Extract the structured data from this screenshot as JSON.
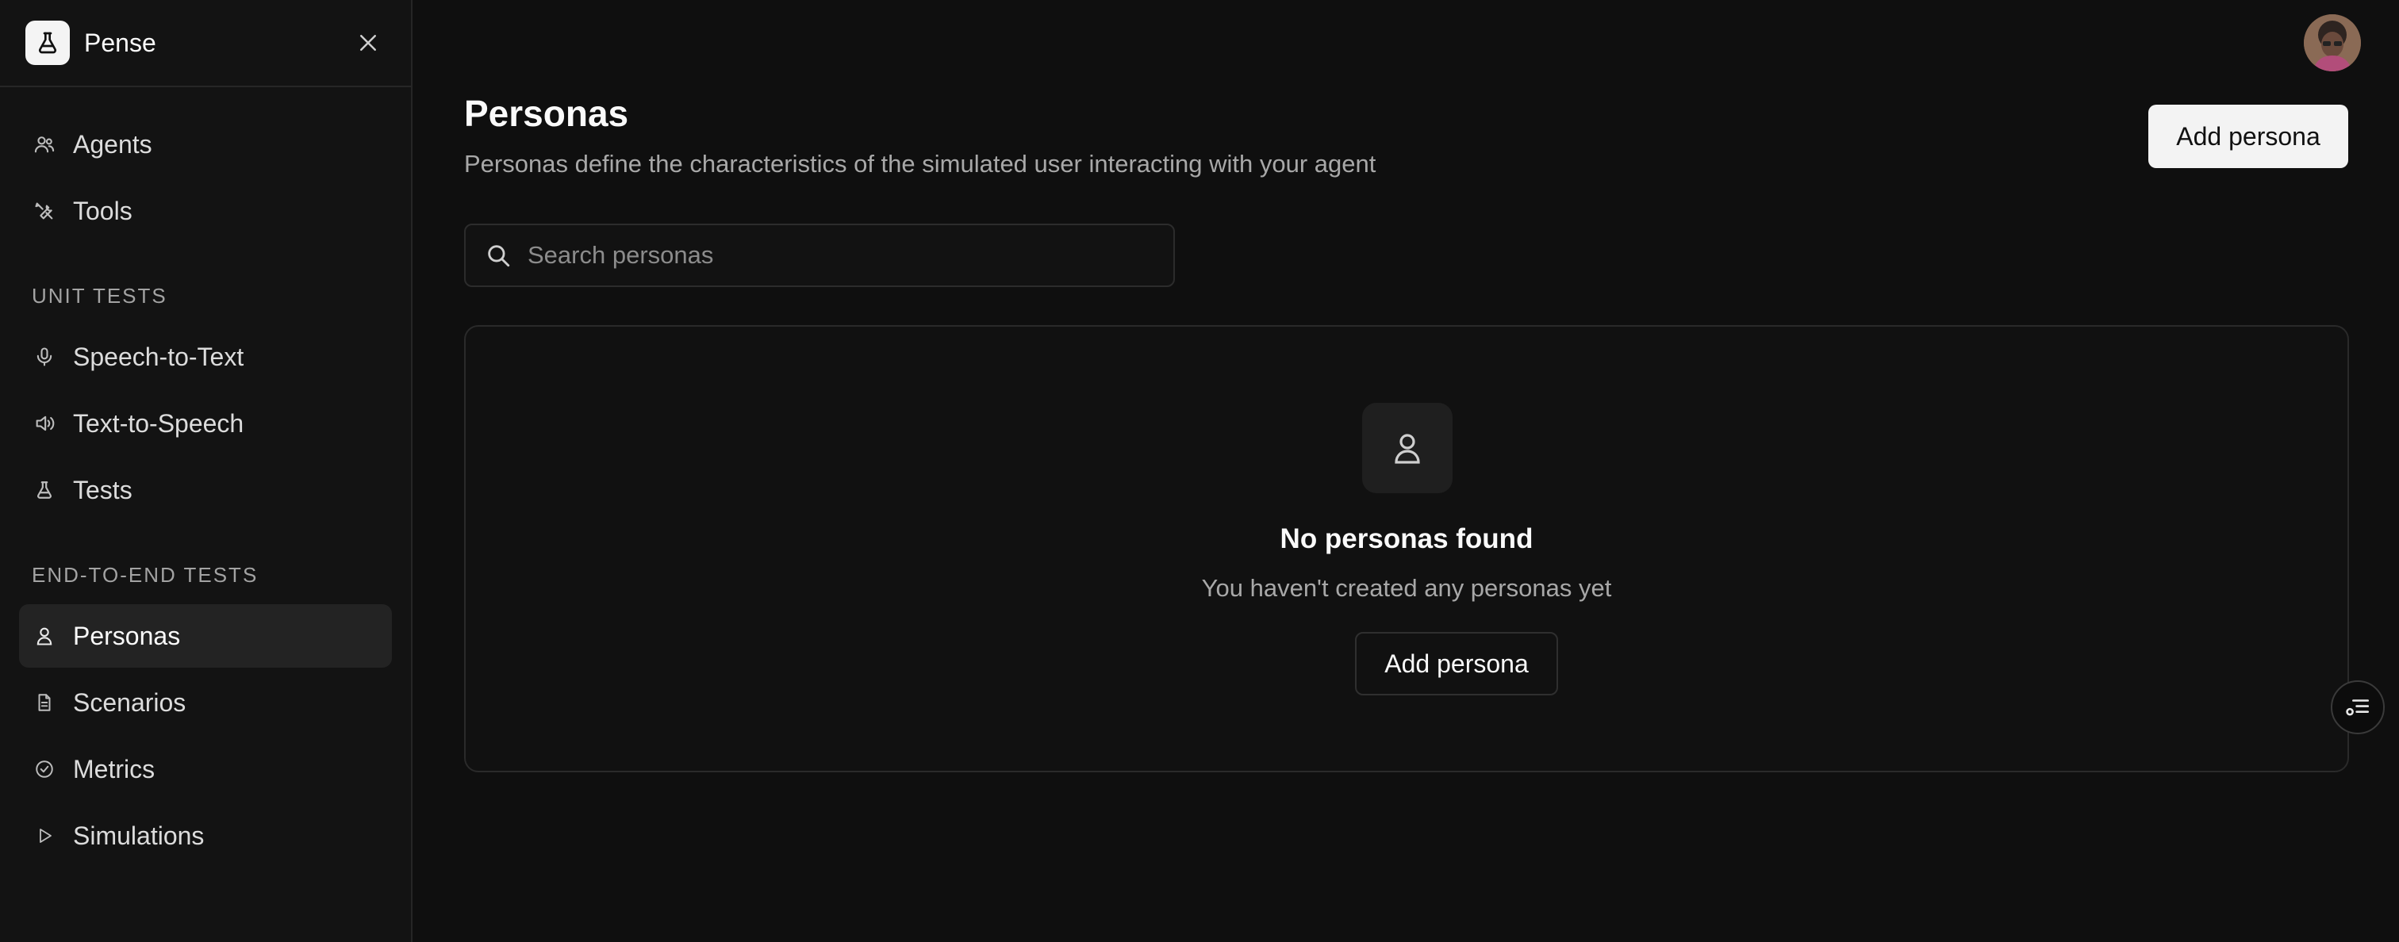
{
  "app": {
    "name": "Pense"
  },
  "sidebar": {
    "items": [
      {
        "label": "Agents",
        "icon": "users-icon"
      },
      {
        "label": "Tools",
        "icon": "tools-icon"
      }
    ],
    "sections": [
      {
        "label": "UNIT TESTS",
        "items": [
          {
            "label": "Speech-to-Text",
            "icon": "microphone-icon"
          },
          {
            "label": "Text-to-Speech",
            "icon": "speaker-icon"
          },
          {
            "label": "Tests",
            "icon": "flask-icon"
          }
        ]
      },
      {
        "label": "END-TO-END TESTS",
        "items": [
          {
            "label": "Personas",
            "icon": "person-icon",
            "active": true
          },
          {
            "label": "Scenarios",
            "icon": "document-icon"
          },
          {
            "label": "Metrics",
            "icon": "check-circle-icon"
          },
          {
            "label": "Simulations",
            "icon": "play-icon"
          }
        ]
      }
    ]
  },
  "header": {
    "title": "Personas",
    "description": "Personas define the characteristics of the simulated user interacting with your agent",
    "add_button": "Add persona"
  },
  "search": {
    "placeholder": "Search personas",
    "value": ""
  },
  "empty_state": {
    "title": "No personas found",
    "subtitle": "You haven't created any personas yet",
    "button": "Add persona"
  },
  "colors": {
    "background": "#0f0f0f",
    "sidebar": "#131313",
    "active_item": "#232323",
    "primary_button": "#f3f3f3"
  }
}
